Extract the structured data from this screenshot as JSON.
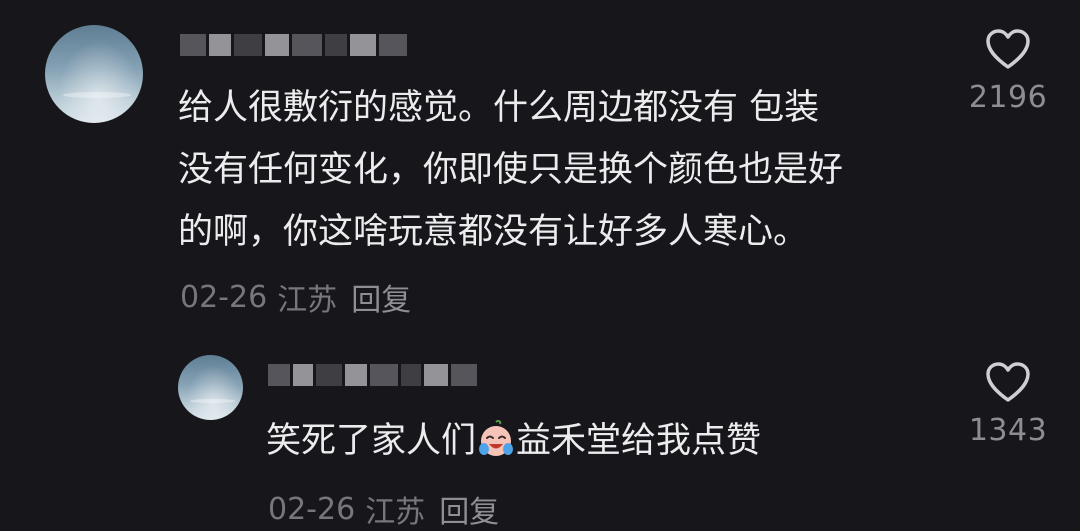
{
  "comments": [
    {
      "text_lines": [
        "给人很敷衍的感觉。什么周边都没有 包装",
        "没有任何变化，你即使只是换个颜色也是好",
        "的啊，你这啥玩意都没有让好多人寒心。"
      ],
      "date": "02-26",
      "location": "江苏",
      "reply_label": "回复",
      "like_count": "2196",
      "like_icon": "heart-outline-icon"
    },
    {
      "text_before_emoji": "笑死了家人们",
      "emoji": "laughing-crying-face-emoji",
      "text_after_emoji": "益禾堂给我点赞",
      "date": "02-26",
      "location": "江苏",
      "reply_label": "回复",
      "like_count": "1343",
      "like_icon": "heart-outline-icon"
    }
  ],
  "colors": {
    "background": "#17161b",
    "primary_text": "#ececee",
    "secondary_text": "#77767c",
    "like_icon": "#cfcfd3"
  }
}
